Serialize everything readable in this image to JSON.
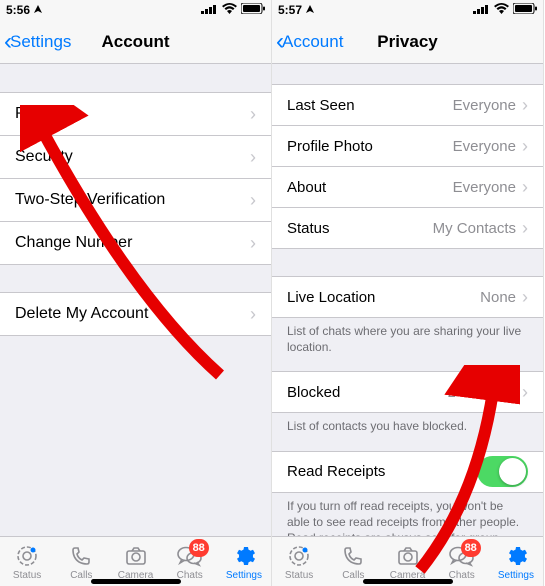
{
  "left": {
    "status_time": "5:56",
    "back_label": "Settings",
    "title": "Account",
    "rows": [
      {
        "label": "Privacy"
      },
      {
        "label": "Security"
      },
      {
        "label": "Two-Step Verification"
      },
      {
        "label": "Change Number"
      },
      {
        "label": "Delete My Account"
      }
    ]
  },
  "right": {
    "status_time": "5:57",
    "back_label": "Account",
    "title": "Privacy",
    "group1": [
      {
        "label": "Last Seen",
        "value": "Everyone"
      },
      {
        "label": "Profile Photo",
        "value": "Everyone"
      },
      {
        "label": "About",
        "value": "Everyone"
      },
      {
        "label": "Status",
        "value": "My Contacts"
      }
    ],
    "live_location": {
      "label": "Live Location",
      "value": "None"
    },
    "live_location_footer": "List of chats where you are sharing your live location.",
    "blocked": {
      "label": "Blocked",
      "value": "2 contacts"
    },
    "blocked_footer": "List of contacts you have blocked.",
    "read_receipts_label": "Read Receipts",
    "read_receipts_footer": "If you turn off read receipts, you won't be able to see read receipts from other people. Read receipts are always sent for group chats."
  },
  "tabs": [
    {
      "label": "Status"
    },
    {
      "label": "Calls"
    },
    {
      "label": "Camera"
    },
    {
      "label": "Chats",
      "badge": "88"
    },
    {
      "label": "Settings",
      "active": true
    }
  ]
}
